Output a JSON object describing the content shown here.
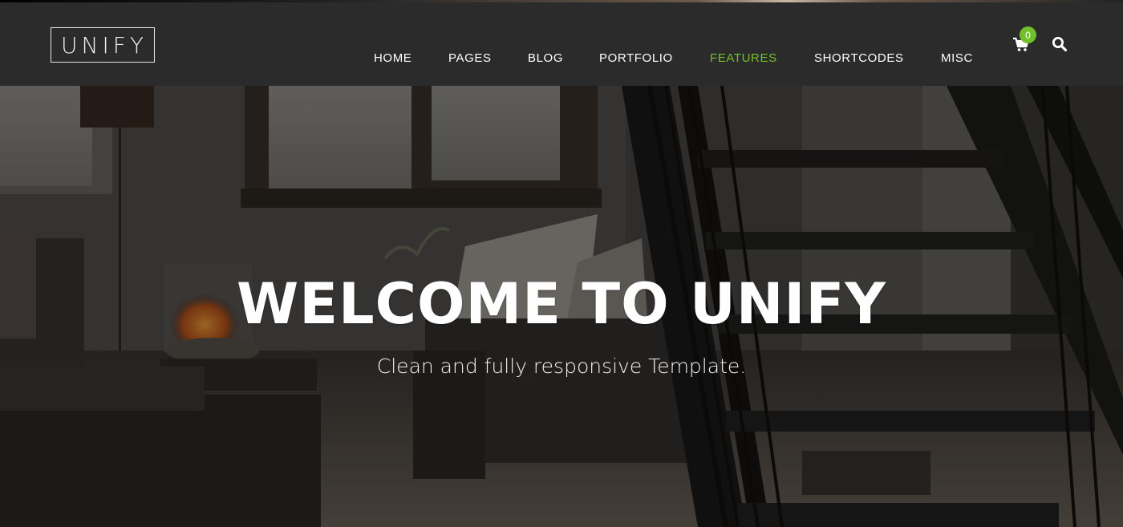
{
  "header": {
    "logo_text": "UNIFY",
    "nav": [
      {
        "label": "HOME",
        "active": false
      },
      {
        "label": "PAGES",
        "active": false
      },
      {
        "label": "BLOG",
        "active": false
      },
      {
        "label": "PORTFOLIO",
        "active": false
      },
      {
        "label": "FEATURES",
        "active": true
      },
      {
        "label": "SHORTCODES",
        "active": false
      },
      {
        "label": "MISC",
        "active": false
      }
    ],
    "cart": {
      "icon": "shopping-cart-icon",
      "count": "0"
    },
    "search": {
      "icon": "search-icon"
    }
  },
  "hero": {
    "title": "WELCOME TO UNIFY",
    "subtitle": "Clean and fully responsive Template."
  },
  "colors": {
    "accent": "#72c02c",
    "header_bg": "#2b2b2b",
    "nav_text": "#ffffff"
  }
}
